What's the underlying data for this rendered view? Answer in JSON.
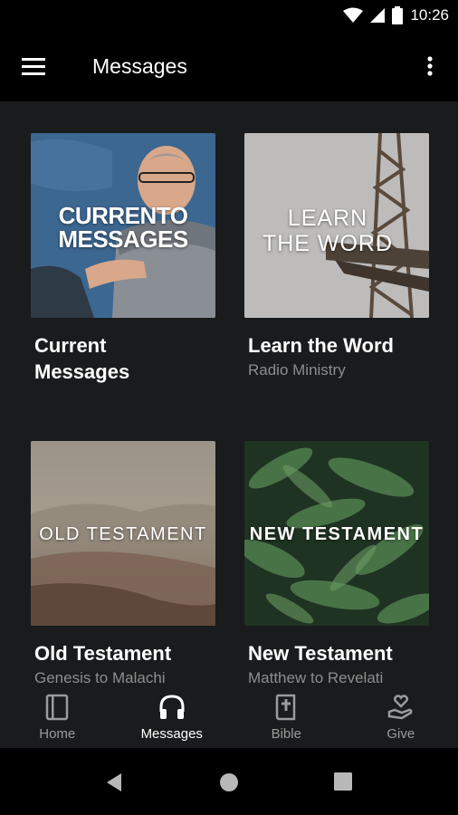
{
  "status": {
    "time": "10:26"
  },
  "header": {
    "title": "Messages"
  },
  "cards": [
    {
      "thumb_text": [
        "CURRENTO",
        "MESSAGES"
      ],
      "title": "Current Messages",
      "subtitle": ""
    },
    {
      "thumb_text": [
        "LEARN",
        "THE WORD"
      ],
      "title": "Learn the Word",
      "subtitle": "Radio Ministry"
    },
    {
      "thumb_text": [
        "OLD TESTAMENT"
      ],
      "title": "Old Testament",
      "subtitle": "Genesis to Malachi"
    },
    {
      "thumb_text": [
        "NEW TESTAMENT"
      ],
      "title": "New Testament",
      "subtitle": "Matthew to Revelati"
    }
  ],
  "nav": {
    "items": [
      {
        "label": "Home",
        "icon": "book-outline-icon"
      },
      {
        "label": "Messages",
        "icon": "headphones-icon"
      },
      {
        "label": "Bible",
        "icon": "bible-icon"
      },
      {
        "label": "Give",
        "icon": "give-heart-hand-icon"
      }
    ],
    "active": "Messages"
  },
  "colors": {
    "background": "#1a1b1c",
    "bar": "#000000",
    "inactive": "#9b9b9b",
    "subtitle": "#8d8d8d"
  }
}
